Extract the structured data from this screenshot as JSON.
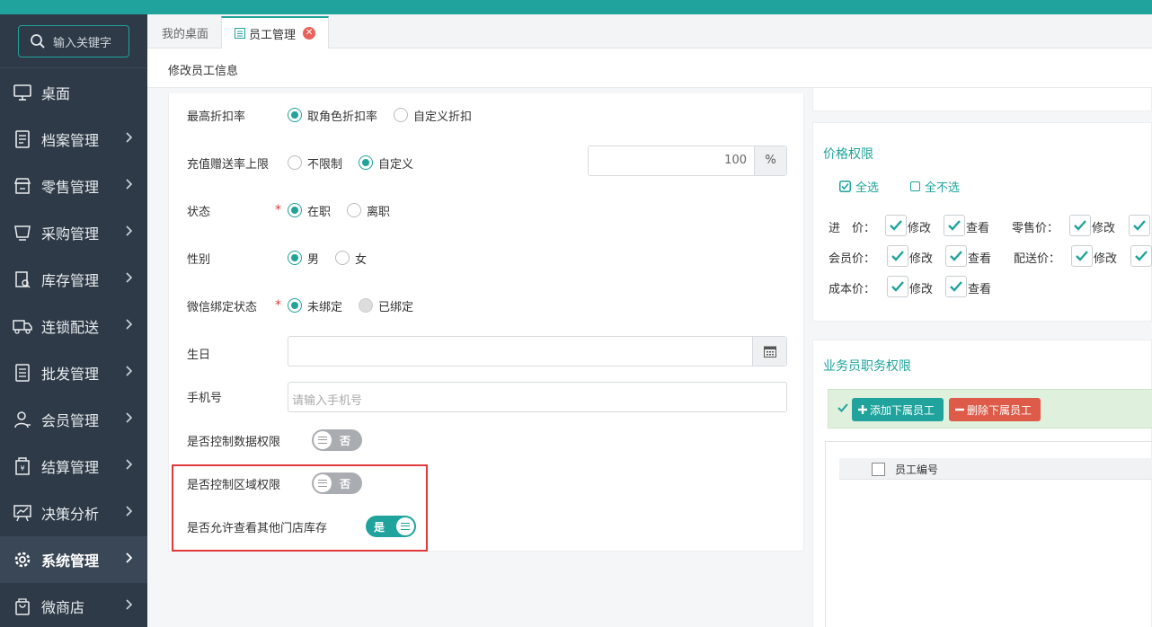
{
  "app": {
    "logo_text": "",
    "search_placeholder": "输入关键字"
  },
  "sidebar": {
    "items": [
      {
        "label": "桌面",
        "icon": "monitor-icon",
        "has_arrow": false
      },
      {
        "label": "档案管理",
        "icon": "file-icon",
        "has_arrow": true
      },
      {
        "label": "零售管理",
        "icon": "store-icon",
        "has_arrow": true
      },
      {
        "label": "采购管理",
        "icon": "purchase-icon",
        "has_arrow": true
      },
      {
        "label": "库存管理",
        "icon": "inventory-icon",
        "has_arrow": true
      },
      {
        "label": "连锁配送",
        "icon": "truck-icon",
        "has_arrow": true
      },
      {
        "label": "批发管理",
        "icon": "wholesale-icon",
        "has_arrow": true
      },
      {
        "label": "会员管理",
        "icon": "user-icon",
        "has_arrow": true
      },
      {
        "label": "结算管理",
        "icon": "settlement-icon",
        "has_arrow": true
      },
      {
        "label": "决策分析",
        "icon": "chart-icon",
        "has_arrow": true
      },
      {
        "label": "系统管理",
        "icon": "gear-icon",
        "has_arrow": true,
        "active": true
      },
      {
        "label": "微商店",
        "icon": "shop-bag-icon",
        "has_arrow": true
      }
    ]
  },
  "tabs": {
    "home": "我的桌面",
    "current": "员工管理"
  },
  "page": {
    "title": "修改员工信息"
  },
  "form": {
    "max_discount": {
      "label": "最高折扣率",
      "options": [
        "取角色折扣率",
        "自定义折扣"
      ],
      "selected": 0
    },
    "recharge_limit": {
      "label": "充值赠送率上限",
      "options": [
        "不限制",
        "自定义"
      ],
      "selected": 1,
      "value": "100",
      "unit": "%"
    },
    "status": {
      "label": "状态",
      "required": "*",
      "options": [
        "在职",
        "离职"
      ],
      "selected": 0
    },
    "gender": {
      "label": "性别",
      "options": [
        "男",
        "女"
      ],
      "selected": 0
    },
    "wechat": {
      "label": "微信绑定状态",
      "required": "*",
      "options": [
        "未绑定",
        "已绑定"
      ],
      "selected": 0
    },
    "birthday": {
      "label": "生日",
      "value": ""
    },
    "phone": {
      "label": "手机号",
      "placeholder": "请输入手机号"
    },
    "data_perm": {
      "label": "是否控制数据权限",
      "state": "否"
    },
    "region_perm": {
      "label": "是否控制区域权限",
      "state": "否"
    },
    "other_stock": {
      "label": "是否允许查看其他门店库存",
      "state": "是"
    }
  },
  "price_perm": {
    "title": "价格权限",
    "select_all": "全选",
    "select_none": "全不选",
    "rows": [
      {
        "label": "进　价：",
        "opts": [
          "修改",
          "查看"
        ]
      },
      {
        "label": "零售价：",
        "opts": [
          "修改"
        ]
      },
      {
        "label": "会员价：",
        "opts": [
          "修改",
          "查看"
        ]
      },
      {
        "label": "配送价：",
        "opts": [
          "修改"
        ]
      },
      {
        "label": "成本价：",
        "opts": [
          "修改",
          "查看"
        ]
      }
    ]
  },
  "salesman": {
    "title": "业务员职务权限",
    "add_btn": "添加下属员工",
    "del_btn": "删除下属员工",
    "col_emp_no": "员工编号"
  },
  "colors": {
    "accent": "#1fa39c",
    "danger": "#e4393c",
    "sidebar_bg": "#2e3a47"
  }
}
